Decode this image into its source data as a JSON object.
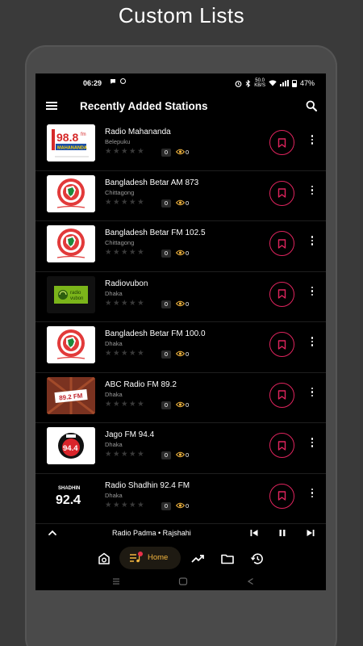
{
  "promo_title": "Custom Lists",
  "status_bar": {
    "time": "06:29",
    "network": "50.0\nKB/S",
    "battery": "47%"
  },
  "app_bar": {
    "title": "Recently Added Stations"
  },
  "stations": [
    {
      "name": "Radio Mahananda",
      "location": "Belepuku",
      "stars": "★★★★★",
      "rating_count": "0",
      "views": "0",
      "logo": "mahananda-logo"
    },
    {
      "name": "Bangladesh Betar AM 873",
      "location": "Chittagong",
      "stars": "★★★★★",
      "rating_count": "0",
      "views": "0",
      "logo": "bangladesh-betar-logo"
    },
    {
      "name": "Bangladesh Betar FM 102.5",
      "location": "Chittagong",
      "stars": "★★★★★",
      "rating_count": "0",
      "views": "0",
      "logo": "bangladesh-betar-logo"
    },
    {
      "name": "Radiovubon",
      "location": "Dhaka",
      "stars": "★★★★★",
      "rating_count": "0",
      "views": "0",
      "logo": "radiovubon-logo"
    },
    {
      "name": "Bangladesh Betar FM 100.0",
      "location": "Dhaka",
      "stars": "★★★★★",
      "rating_count": "0",
      "views": "0",
      "logo": "bangladesh-betar-logo"
    },
    {
      "name": "ABC Radio FM 89.2",
      "location": "Dhaka",
      "stars": "★★★★★",
      "rating_count": "0",
      "views": "0",
      "logo": "abc-radio-logo"
    },
    {
      "name": "Jago FM 94.4",
      "location": "Dhaka",
      "stars": "★★★★★",
      "rating_count": "0",
      "views": "0",
      "logo": "jago-fm-logo"
    },
    {
      "name": "Radio Shadhin 92.4 FM",
      "location": "Dhaka",
      "stars": "★★★★★",
      "rating_count": "0",
      "views": "0",
      "logo": "radio-shadhin-logo"
    }
  ],
  "logo_text": {
    "mahananda_freq": "98.8",
    "mahananda_fm": "fm",
    "mahananda_name": "MAHANANDA",
    "radiovubon": "radio\nvubon",
    "abc": "89.2 FM",
    "jago": "94.4",
    "shadhin_brand": "SHADHIN",
    "shadhin_freq": "92.4"
  },
  "player": {
    "now_playing": "Radio Padma • Rajshahi"
  },
  "bottom_nav": {
    "home_label": "Home"
  },
  "colors": {
    "accent_pink": "#e0245e",
    "accent_orange": "#f4b63f",
    "background": "#000000"
  }
}
